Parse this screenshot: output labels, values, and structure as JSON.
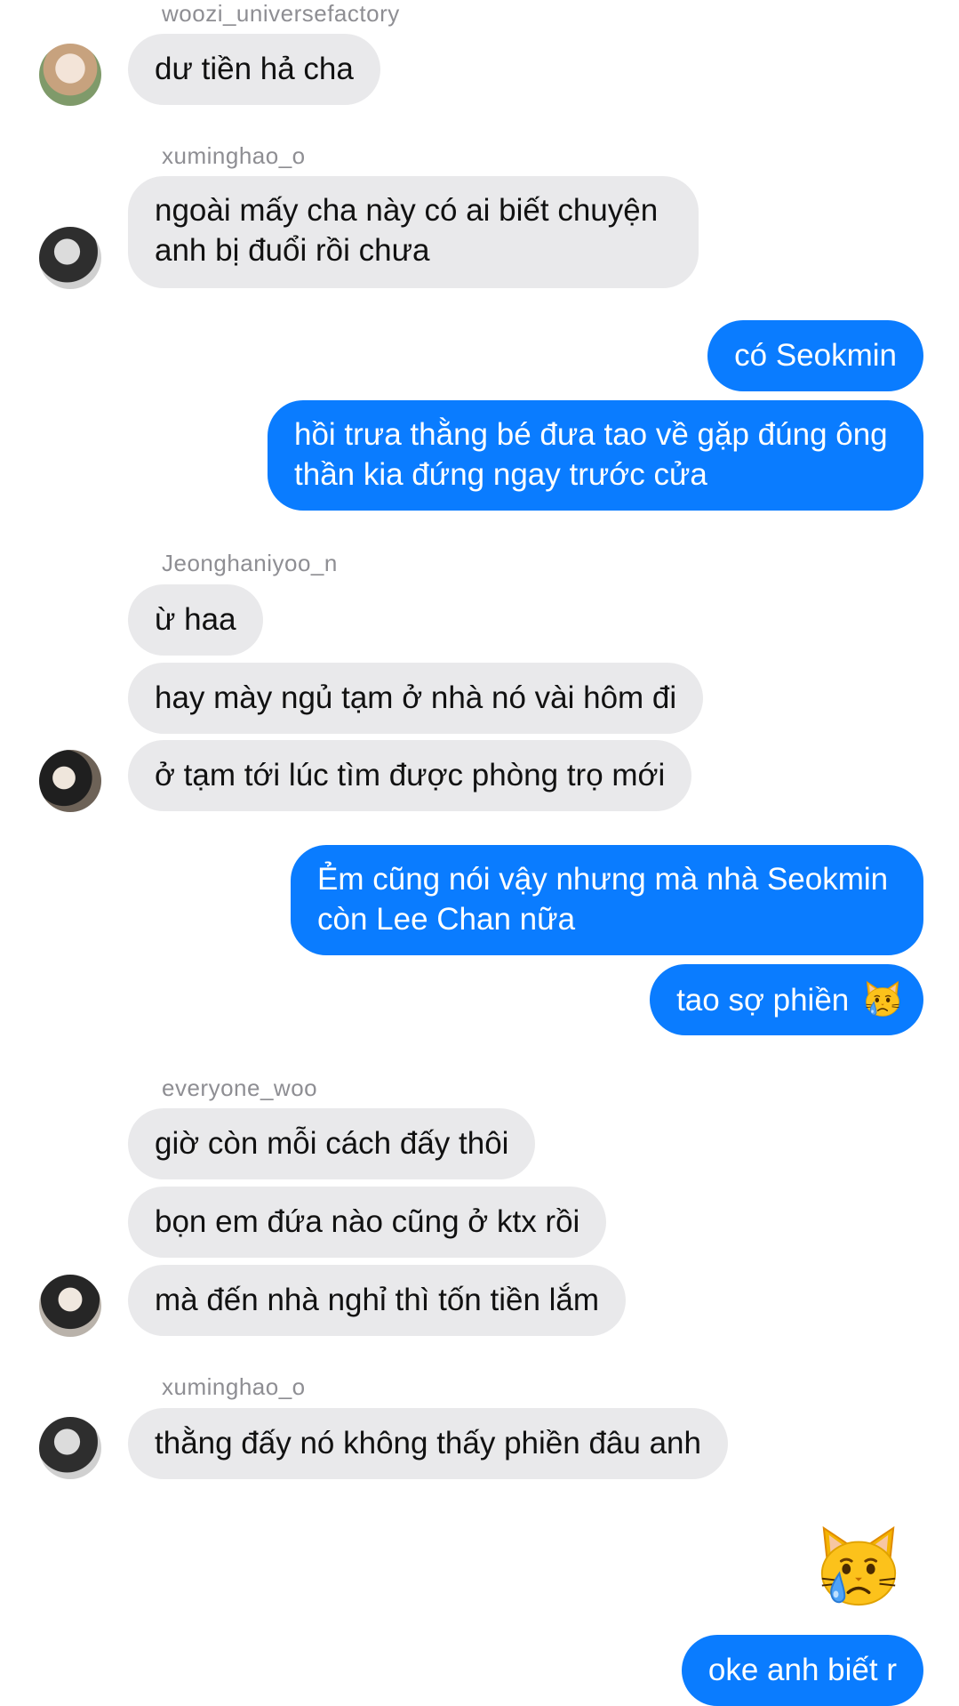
{
  "colors": {
    "incoming_bubble": "#e9e9eb",
    "outgoing_bubble": "#0a7cff",
    "sender_name": "#8e8e93"
  },
  "senders": {
    "s1": "woozi_universefactory",
    "s2": "xuminghao_o",
    "s3": "Jeonghaniyoo_n",
    "s4": "everyone_woo",
    "s5": "xuminghao_o"
  },
  "messages": {
    "m1": "dư tiền hả cha",
    "m2": "ngoài mấy cha này có ai biết chuyện\nanh bị đuổi rồi chưa",
    "m3": "có Seokmin",
    "m4": "hồi trưa thằng bé đưa tao về gặp đúng ông\nthần kia đứng ngay trước cửa",
    "m5": "ừ haa",
    "m6": "hay mày ngủ tạm ở nhà nó vài hôm đi",
    "m7": "ở tạm tới lúc tìm được phòng trọ mới",
    "m8": "Ẻm cũng nói vậy nhưng mà nhà Seokmin\ncòn Lee Chan nữa",
    "m9": "tao sợ phiền",
    "m10": "giờ còn mỗi cách đấy thôi",
    "m11": "bọn em đứa nào cũng ở ktx rồi",
    "m12": "mà đến nhà nghỉ thì tốn tiền lắm",
    "m13": "thằng đấy nó không thấy phiền đâu anh",
    "m14": "crying-cat-emoji",
    "m15": "oke anh biết r"
  },
  "icons": {
    "emoji": "crying-cat-face",
    "avatars": [
      "avatar-woozi",
      "avatar-xuminghao",
      "avatar-jeonghan",
      "avatar-everyone-woo",
      "avatar-xuminghao"
    ]
  }
}
